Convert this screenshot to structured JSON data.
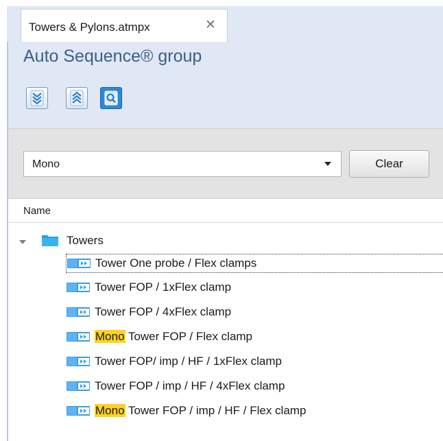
{
  "tab": {
    "title": "Towers & Pylons.atmpx",
    "close_glyph": "✕"
  },
  "panel": {
    "title": "Auto Sequence® group"
  },
  "toolbar": {
    "buttons": [
      {
        "icon": "expand-all-icon"
      },
      {
        "icon": "collapse-all-icon"
      },
      {
        "icon": "search-icon",
        "active": true
      }
    ]
  },
  "filter": {
    "value": "Mono",
    "clear_label": "Clear"
  },
  "columns": {
    "name": "Name"
  },
  "tree": {
    "root": {
      "label": "Towers",
      "icon": "folder-icon"
    },
    "items": [
      {
        "highlight": "",
        "text": "Tower One probe / Flex clamps"
      },
      {
        "highlight": "",
        "text": "Tower FOP / 1xFlex clamp"
      },
      {
        "highlight": "",
        "text": "Tower FOP / 4xFlex clamp"
      },
      {
        "highlight": "Mono",
        "text": " Tower FOP / Flex clamp"
      },
      {
        "highlight": "",
        "text": "Tower FOP/ imp / HF / 1xFlex clamp"
      },
      {
        "highlight": "",
        "text": "Tower FOP / imp / HF / 4xFlex clamp"
      },
      {
        "highlight": "Mono",
        "text": " Tower FOP / imp / HF / Flex clamp"
      }
    ]
  },
  "colors": {
    "accent": "#2a8ad8",
    "title_blue": "#3b5f8a",
    "highlight": "#ffd21e",
    "panel_bg": "#dfe8f4"
  }
}
